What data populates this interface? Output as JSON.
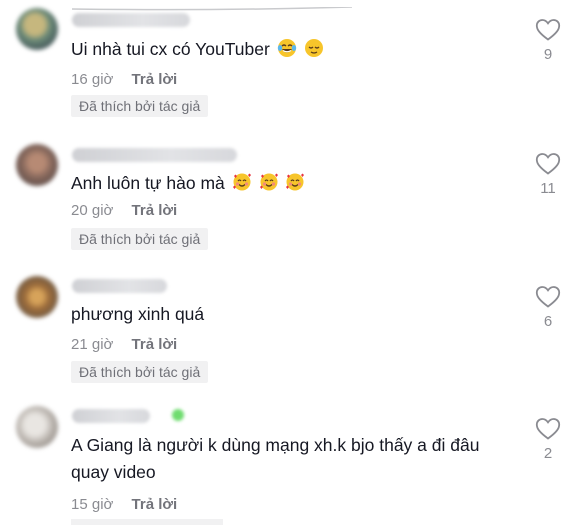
{
  "comments": [
    {
      "text": "Ui nhà tui cx có YouTuber",
      "emojis": [
        "face-with-tears-of-joy",
        "relieved-face"
      ],
      "time": "16 giờ",
      "reply_label": "Trả lời",
      "liked_badge": "Đã thích bởi tác giả",
      "likes": "9"
    },
    {
      "text": "Anh luôn tự hào mà",
      "emojis": [
        "smiling-face-with-hearts",
        "smiling-face-with-hearts",
        "smiling-face-with-hearts"
      ],
      "time": "20 giờ",
      "reply_label": "Trả lời",
      "liked_badge": "Đã thích bởi tác giả",
      "likes": "11"
    },
    {
      "text": "phương xinh quá",
      "emojis": [],
      "time": "21 giờ",
      "reply_label": "Trả lời",
      "liked_badge": "Đã thích bởi tác giả",
      "likes": "6"
    },
    {
      "text": "A Giang là người k dùng mạng xh.k bjo thấy a đi đâu quay video",
      "emojis": [],
      "time": "15 giờ",
      "reply_label": "Trả lời",
      "liked_badge": "",
      "likes": "2"
    }
  ],
  "icons": {
    "like": "heart-outline-icon"
  },
  "colors": {
    "text": "#161823",
    "secondary": "#8a8b91",
    "badge_bg": "#f1f1f2",
    "online": "#6fdc6f"
  }
}
